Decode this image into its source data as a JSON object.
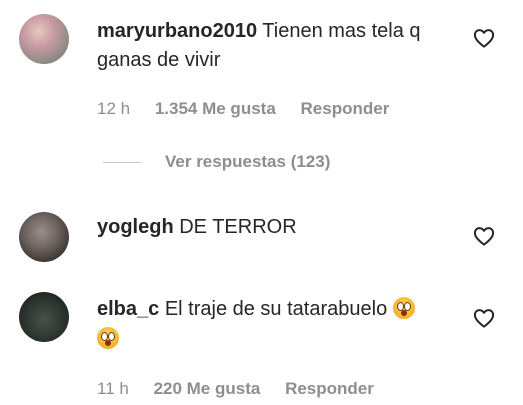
{
  "comments": [
    {
      "username": "maryurbano2010",
      "text_line1": "Tienen mas tela q",
      "text_line2": "ganas de vivir",
      "time": "12 h",
      "likes": "1.354 Me gusta",
      "reply_label": "Responder",
      "view_replies": "Ver respuestas (123)",
      "avatar_icon": "user-photo-avatar"
    },
    {
      "username": "yoglegh",
      "text_line1": "DE TERROR",
      "avatar_icon": "user-photo-avatar"
    },
    {
      "username": "elba_c",
      "text_line1": "El traje de su tatarabuelo",
      "time": "11 h",
      "likes": "220 Me gusta",
      "reply_label": "Responder",
      "emoji": "face-screaming-emoji",
      "avatar_icon": "user-photo-avatar"
    }
  ],
  "icons": {
    "like": "heart-icon"
  },
  "colors": {
    "text": "#262626",
    "secondary": "#8e8e8e"
  }
}
